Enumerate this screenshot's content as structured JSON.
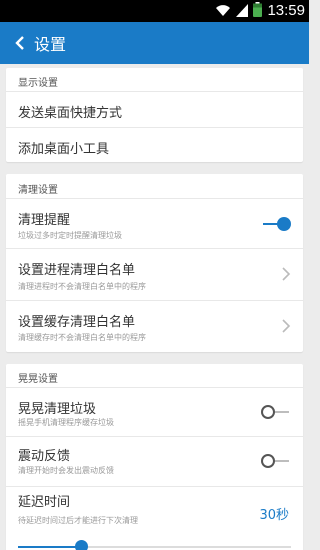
{
  "status_bar": {
    "time": "13:59"
  },
  "app_bar": {
    "title": "设置"
  },
  "display": {
    "header": "显示设置",
    "items": [
      {
        "title": "发送桌面快捷方式"
      },
      {
        "title": "添加桌面小工具"
      }
    ]
  },
  "clean": {
    "header": "清理设置",
    "reminder": {
      "title": "清理提醒",
      "subtitle": "垃圾过多时定时提醒清理垃圾",
      "enabled": true
    },
    "process_whitelist": {
      "title": "设置进程清理白名单",
      "subtitle": "清理进程时不会清理白名单中的程序"
    },
    "cache_whitelist": {
      "title": "设置缓存清理白名单",
      "subtitle": "清理缓存时不会清理白名单中的程序"
    }
  },
  "shake": {
    "header": "晃晃设置",
    "shake_clean": {
      "title": "晃晃清理垃圾",
      "subtitle": "摇晃手机清理程序缓存垃圾",
      "enabled": false
    },
    "vibration": {
      "title": "震动反馈",
      "subtitle": "清理开始时会发出震动反馈",
      "enabled": false
    },
    "delay": {
      "title": "延迟时间",
      "subtitle": "待延迟时间过后才能进行下次清理",
      "value": "30秒",
      "slider_fraction": 0.23
    }
  },
  "colors": {
    "accent": "#1a7bc7",
    "background": "#ececec"
  }
}
